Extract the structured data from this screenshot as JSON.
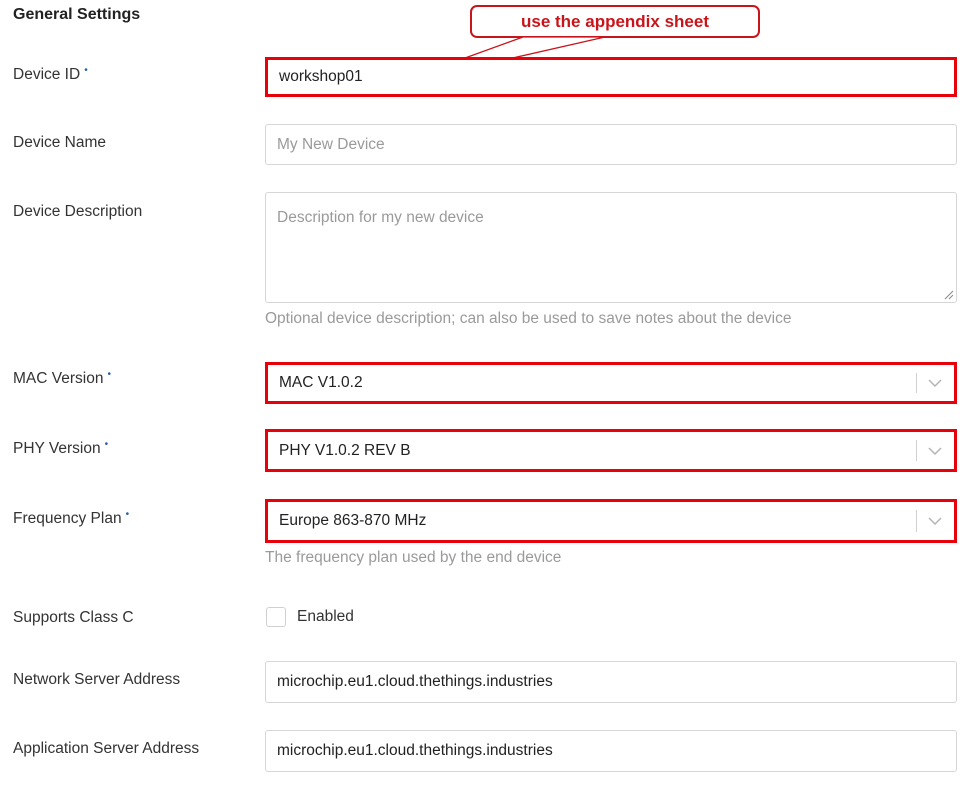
{
  "section_title": "General Settings",
  "annotation": {
    "text": "use the appendix sheet",
    "color": "#c8151b"
  },
  "highlight_color": "#e8000b",
  "required_marker": "•",
  "fields": {
    "device_id": {
      "label": "Device ID",
      "value": "workshop01"
    },
    "device_name": {
      "label": "Device Name",
      "placeholder": "My New Device"
    },
    "device_description": {
      "label": "Device Description",
      "placeholder": "Description for my new device",
      "hint": "Optional device description; can also be used to save notes about the device"
    },
    "mac_version": {
      "label": "MAC Version",
      "value": "MAC V1.0.2"
    },
    "phy_version": {
      "label": "PHY Version",
      "value": "PHY V1.0.2 REV B"
    },
    "frequency_plan": {
      "label": "Frequency Plan",
      "value": "Europe 863-870 MHz",
      "hint": "The frequency plan used by the end device"
    },
    "supports_class_c": {
      "label": "Supports Class C",
      "checkbox_label": "Enabled",
      "checked": false
    },
    "network_server_address": {
      "label": "Network Server Address",
      "value": "microchip.eu1.cloud.thethings.industries"
    },
    "application_server_address": {
      "label": "Application Server Address",
      "value": "microchip.eu1.cloud.thethings.industries"
    }
  },
  "icons": {
    "dropdown": "chevron-down-icon",
    "resize": "resize-grip-icon"
  }
}
